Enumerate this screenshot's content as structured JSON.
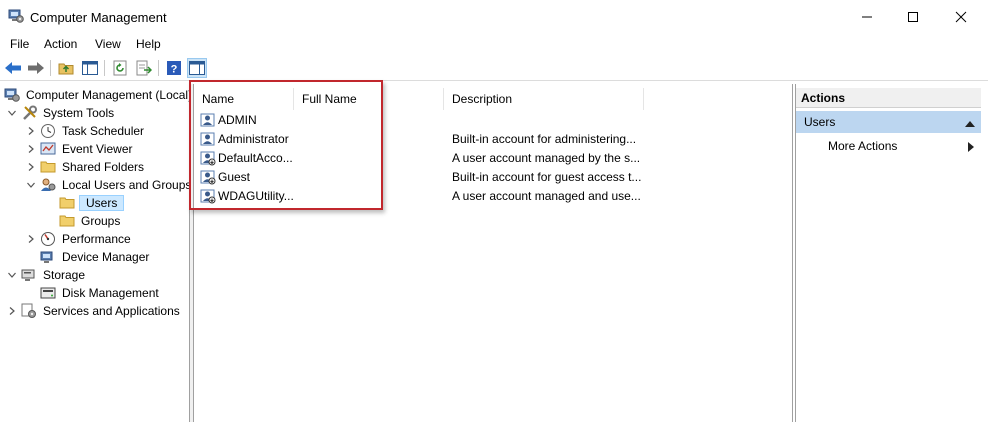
{
  "window": {
    "title": "Computer Management"
  },
  "menu": [
    "File",
    "Action",
    "View",
    "Help"
  ],
  "tree": {
    "root": "Computer Management (Local)",
    "system_tools": "System Tools",
    "task_scheduler": "Task Scheduler",
    "event_viewer": "Event Viewer",
    "shared_folders": "Shared Folders",
    "local_users_groups": "Local Users and Groups",
    "users": "Users",
    "groups": "Groups",
    "performance": "Performance",
    "device_manager": "Device Manager",
    "storage": "Storage",
    "disk_management": "Disk Management",
    "services_apps": "Services and Applications"
  },
  "list": {
    "columns": [
      "Name",
      "Full Name",
      "Description"
    ],
    "rows": [
      {
        "name": "ADMIN",
        "full_name": "",
        "description": ""
      },
      {
        "name": "Administrator",
        "full_name": "",
        "description": "Built-in account for administering..."
      },
      {
        "name": "DefaultAcco...",
        "full_name": "",
        "description": "A user account managed by the s..."
      },
      {
        "name": "Guest",
        "full_name": "",
        "description": "Built-in account for guest access t..."
      },
      {
        "name": "WDAGUtility...",
        "full_name": "",
        "description": "A user account managed and use..."
      }
    ]
  },
  "actions": {
    "title": "Actions",
    "section": "Users",
    "more_actions": "More Actions"
  },
  "colors": {
    "highlight_border": "#c1272d",
    "selection": "#cce8ff",
    "actions_section": "#bcd6f0"
  },
  "icons": [
    "computer-management-icon",
    "back-arrow-icon",
    "forward-arrow-icon",
    "up-folder-icon",
    "show-hide-tree-icon",
    "refresh-icon",
    "export-list-icon",
    "help-icon",
    "action-pane-icon",
    "user-icon",
    "folder-icon",
    "gear-icon",
    "clock-icon",
    "event-viewer-icon",
    "performance-icon",
    "disk-icon"
  ]
}
